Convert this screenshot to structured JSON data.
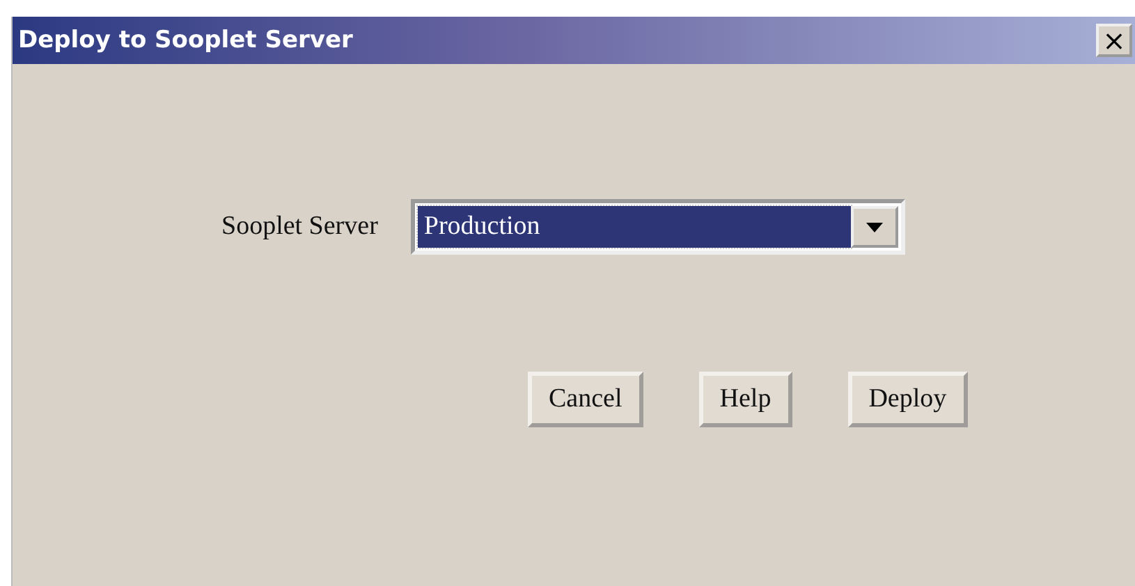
{
  "window": {
    "title": "Deploy to Sooplet Server",
    "close": "×"
  },
  "field": {
    "label": "Sooplet Server",
    "value": "Production"
  },
  "buttons": [
    "Cancel",
    "Help",
    "Deploy"
  ]
}
